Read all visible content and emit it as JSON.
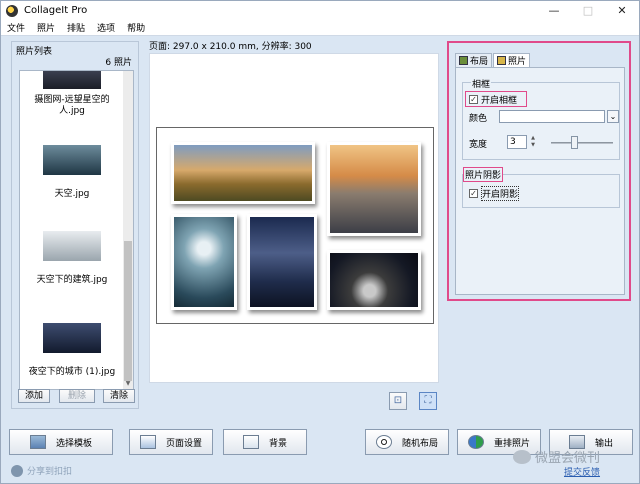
{
  "window": {
    "title": "CollageIt Pro",
    "minimize": "—",
    "restore": "□",
    "close": "✕"
  },
  "menu": [
    "文件",
    "照片",
    "排贴",
    "选项",
    "帮助"
  ],
  "photo_list": {
    "title": "照片列表",
    "count": "6 照片",
    "items": [
      {
        "label": "摄图网-远望星空的人.jpg"
      },
      {
        "label": "天空.jpg"
      },
      {
        "label": "天空下的建筑.jpg"
      },
      {
        "label": "夜空下的城市 (1).jpg"
      }
    ],
    "buttons": {
      "add": "添加",
      "remove": "删除",
      "clear": "清除"
    }
  },
  "page_info": "页面: 297.0 x 210.0 mm, 分辨率: 300",
  "right_panel": {
    "tabs": {
      "layout": "布局",
      "photo": "照片"
    },
    "frame": {
      "group_label": "相框",
      "enable_label": "开启相框",
      "enabled": true,
      "color_label": "颜色",
      "width_label": "宽度",
      "width_value": "3"
    },
    "shadow": {
      "group_label": "照片阴影",
      "enable_label": "开启阴影",
      "enabled": true
    }
  },
  "bottom_buttons": {
    "template": "选择模板",
    "page_setup": "页面设置",
    "background": "背景",
    "random_layout": "随机布局",
    "rearrange": "重排照片",
    "output": "输出"
  },
  "footer": {
    "left": "分享到扣扣",
    "right": "提交反馈",
    "watermark": "微盟会微刊"
  }
}
